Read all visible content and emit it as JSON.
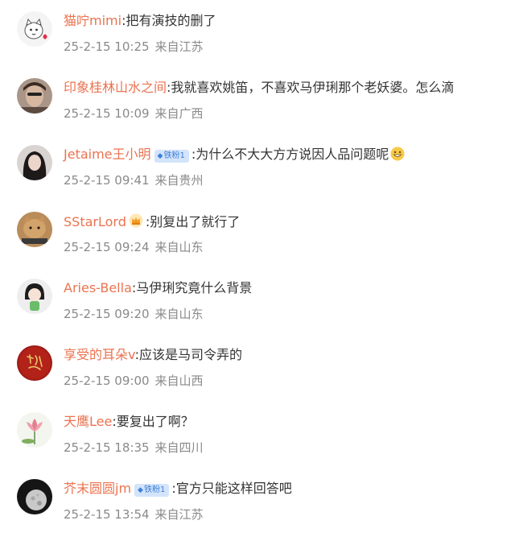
{
  "comments": [
    {
      "username": "猫咛mimi",
      "separator": ":",
      "text": "把有演技的删了",
      "date": "25-2-15 10:25",
      "location": "来自江苏",
      "avatar_icon": "cartoon-cat-avatar"
    },
    {
      "username": "印象桂林山水之间",
      "separator": ":",
      "text": "我就喜欢姚笛，不喜欢马伊琍那个老妖婆。怎么滴",
      "date": "25-2-15 10:09",
      "location": "来自广西",
      "avatar_icon": "man-photo-avatar"
    },
    {
      "username": "Jetaime王小明",
      "separator": ":",
      "badge": "铁粉1",
      "text": "为什么不大大方方说因人品问题呢",
      "date": "25-2-15 09:41",
      "location": "来自贵州",
      "avatar_icon": "woman-photo-avatar",
      "trailing_icon": "grinning-face-icon"
    },
    {
      "username": "SStarLord",
      "separator": ":",
      "text": "别复出了就行了",
      "date": "25-2-15 09:24",
      "location": "来自山东",
      "avatar_icon": "cat-meme-avatar",
      "member_icon": "crown-icon"
    },
    {
      "username": "Aries-Bella",
      "separator": ":",
      "text": "马伊琍究竟什么背景",
      "date": "25-2-15 09:20",
      "location": "来自山东",
      "avatar_icon": "cartoon-girl-avatar"
    },
    {
      "username": "享受的耳朵v",
      "separator": ":",
      "text": "应该是马司令弄的",
      "date": "25-2-15 09:00",
      "location": "来自山西",
      "avatar_icon": "red-calligraphy-avatar"
    },
    {
      "username": "天鹰Lee",
      "separator": ":",
      "text": "要复出了啊？",
      "date": "25-2-15 18:35",
      "location": "来自四川",
      "avatar_icon": "lotus-avatar"
    },
    {
      "username": "芥末圆圆jm",
      "separator": ":",
      "badge": "铁粉1",
      "text": "官方只能这样回答吧",
      "date": "25-2-15 13:54",
      "location": "来自江苏",
      "avatar_icon": "moon-avatar"
    }
  ],
  "colors": {
    "username": "#eb7350",
    "text": "#333333",
    "meta": "#8a8a8a",
    "badge_bg": "#d3e4fb",
    "badge_fg": "#3f7fd6"
  }
}
